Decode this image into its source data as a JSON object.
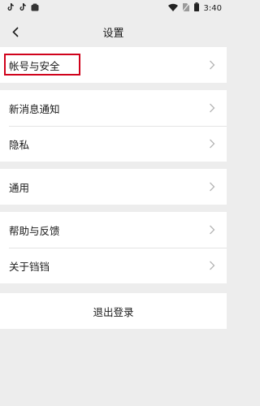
{
  "status_bar": {
    "time": "3:40"
  },
  "nav": {
    "title": "设置"
  },
  "groups": [
    {
      "items": [
        {
          "label": "帐号与安全"
        }
      ]
    },
    {
      "items": [
        {
          "label": "新消息通知"
        },
        {
          "label": "隐私"
        }
      ]
    },
    {
      "items": [
        {
          "label": "通用"
        }
      ]
    },
    {
      "items": [
        {
          "label": "帮助与反馈"
        },
        {
          "label": "关于铛铛"
        }
      ]
    }
  ],
  "logout": {
    "label": "退出登录"
  },
  "colors": {
    "highlight": "#d0021b",
    "background": "#ededed"
  }
}
